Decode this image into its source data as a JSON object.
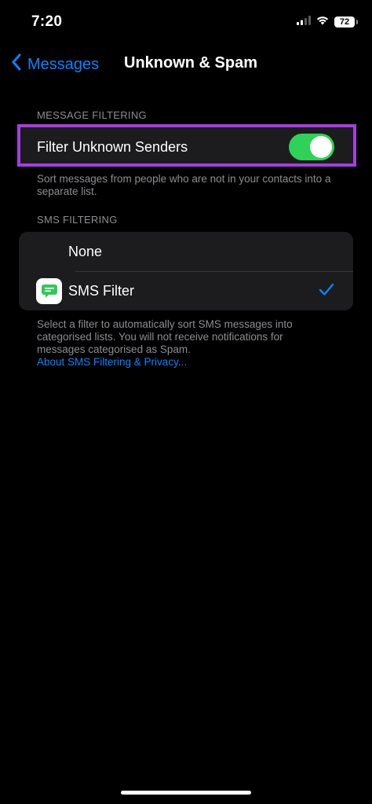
{
  "status_bar": {
    "time": "7:20",
    "battery": "72"
  },
  "nav": {
    "back_label": "Messages",
    "title": "Unknown & Spam"
  },
  "message_filtering": {
    "header": "MESSAGE FILTERING",
    "toggle_label": "Filter Unknown Senders",
    "toggle_on": true,
    "footer": "Sort messages from people who are not in your contacts into a separate list."
  },
  "sms_filtering": {
    "header": "SMS FILTERING",
    "options": [
      {
        "label": "None",
        "selected": false
      },
      {
        "label": "SMS Filter",
        "selected": true
      }
    ],
    "footer_line1": "Select a filter to automatically sort SMS messages into",
    "footer_line2": "categorised lists. You will not receive notifications for",
    "footer_line3": "messages categorised as Spam.",
    "link": "About SMS Filtering & Privacy..."
  },
  "colors": {
    "accent": "#0a84ff",
    "toggle_on": "#30d158",
    "highlight_border": "#a53ee0",
    "icon_green": "#34c759"
  },
  "icons": [
    "back-chevron-icon",
    "cellular-signal-icon",
    "wifi-icon",
    "battery-icon",
    "messages-app-icon",
    "checkmark-icon"
  ]
}
